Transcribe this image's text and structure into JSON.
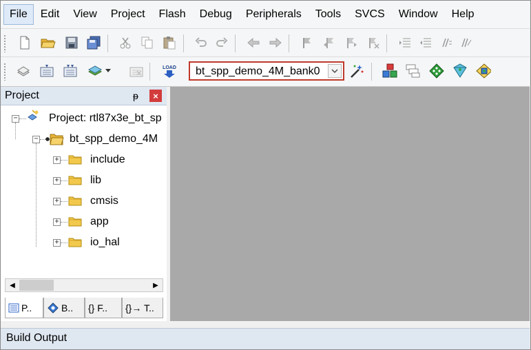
{
  "menu": [
    "File",
    "Edit",
    "View",
    "Project",
    "Flash",
    "Debug",
    "Peripherals",
    "Tools",
    "SVCS",
    "Window",
    "Help"
  ],
  "toolbar2": {
    "target_value": "bt_spp_demo_4M_bank0",
    "load_label": "LOAD"
  },
  "project_panel": {
    "title": "Project",
    "pin_glyph": "ᵽ",
    "tree": {
      "root": "Project: rtl87x3e_bt_sp",
      "target": "bt_spp_demo_4M",
      "groups": [
        "include",
        "lib",
        "cmsis",
        "app",
        "io_hal"
      ]
    },
    "tabs": [
      {
        "label": "P.."
      },
      {
        "label": "B.."
      },
      {
        "label": "{} F.."
      },
      {
        "label": "{}→ T.."
      }
    ]
  },
  "build_output": {
    "title": "Build Output"
  },
  "colors": {
    "accent_border": "#c0392b",
    "panel_header": "#dfe7f1",
    "editor_bg": "#a9a9a9",
    "folder": "#f2c94c"
  }
}
